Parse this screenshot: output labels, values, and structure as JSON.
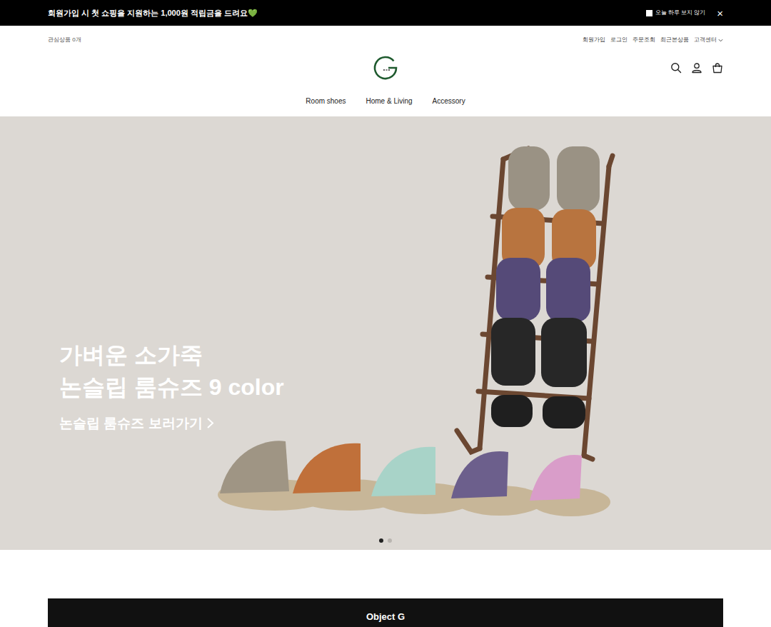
{
  "announcement": {
    "text": "회원가입 시 첫 쇼핑을 지원하는 1,000원 적립금을 드려요💚",
    "hide_today": {
      "label": "오늘 하루 보지 않기",
      "checked": false
    },
    "close": "×"
  },
  "header": {
    "wishlist": "관심상품 0개",
    "links": [
      {
        "label": "회원가입"
      },
      {
        "label": "로그인"
      },
      {
        "label": "주문조회"
      },
      {
        "label": "최근본상품"
      },
      {
        "label": "고객센터"
      }
    ]
  },
  "nav": [
    {
      "label": "Room shoes"
    },
    {
      "label": "Home & Living"
    },
    {
      "label": "Accessory"
    }
  ],
  "hero": {
    "lines": [
      "가벼운 소가죽",
      "논슬립 룸슈즈 9 color"
    ],
    "link": "논슬립 룸슈즈 보러가기",
    "dots": [
      {
        "selected": true
      },
      {
        "selected": false
      }
    ]
  },
  "section": {
    "title": "Object G"
  }
}
